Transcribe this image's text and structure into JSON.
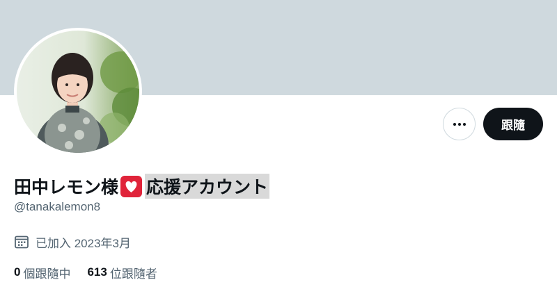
{
  "profile": {
    "name_prefix": "田中レモン様",
    "heart_icon": "red-heart-emoji",
    "name_suffix": "応援アカウント",
    "handle": "@tanakalemon8",
    "joined_text": "已加入 2023年3月",
    "following_count": "0",
    "following_label": "個跟隨中",
    "followers_count": "613",
    "followers_label": "位跟隨者"
  },
  "actions": {
    "more_icon": "more-dots-icon",
    "follow_label": "跟隨"
  },
  "colors": {
    "banner": "#cfd9de",
    "text_primary": "#0f1419",
    "text_secondary": "#536471",
    "follow_bg": "#0f1419",
    "heart": "#e0243a"
  }
}
